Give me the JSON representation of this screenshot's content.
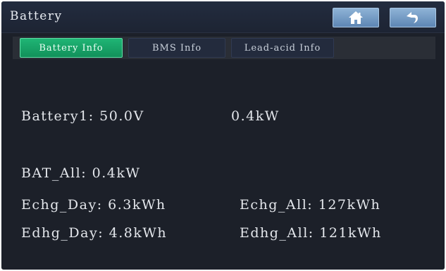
{
  "header": {
    "title": "Battery",
    "home_icon": "home-icon",
    "back_icon": "back-arrow-icon"
  },
  "tabs": [
    {
      "label": "Battery Info",
      "active": true
    },
    {
      "label": "BMS Info",
      "active": false
    },
    {
      "label": "Lead-acid Info",
      "active": false
    }
  ],
  "values": {
    "battery1_voltage": "Battery1: 50.0V",
    "battery1_power": "0.4kW",
    "bat_all": "BAT_All: 0.4kW",
    "echg_day": "Echg_Day: 6.3kWh",
    "echg_all": "Echg_All: 127kWh",
    "edhg_day": "Edhg_Day: 4.8kWh",
    "edhg_all": "Edhg_All: 121kWh"
  },
  "colors": {
    "background": "#1c2029",
    "active_tab": "#18a568",
    "nav_button": "#7fa6cc"
  }
}
